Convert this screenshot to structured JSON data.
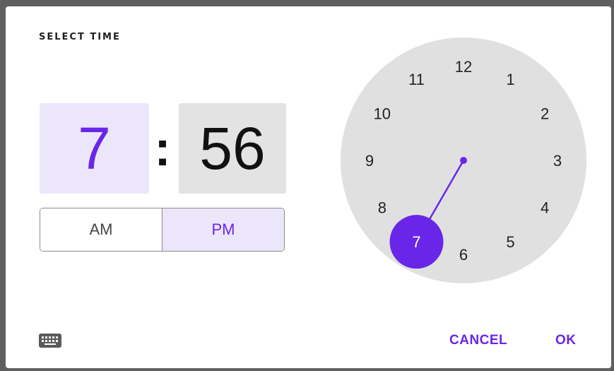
{
  "dialog": {
    "title": "SELECT TIME",
    "hour": "7",
    "separator": ":",
    "minute": "56",
    "period": {
      "am_label": "AM",
      "pm_label": "PM",
      "selected": "PM"
    },
    "clock": {
      "numbers": [
        "12",
        "1",
        "2",
        "3",
        "4",
        "5",
        "6",
        "7",
        "8",
        "9",
        "10",
        "11"
      ],
      "selected_hour": 7,
      "dial_color": "#e0e0e0",
      "accent_color": "#6a26e8"
    },
    "keyboard_icon": "keyboard-icon",
    "cancel_label": "CANCEL",
    "ok_label": "OK"
  }
}
